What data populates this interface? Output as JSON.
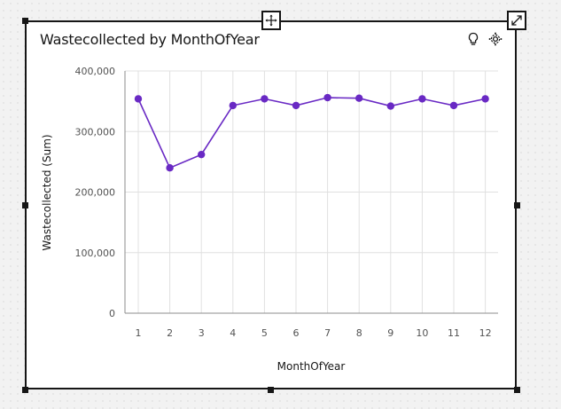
{
  "card": {
    "title": "Wastecollected by MonthOfYear"
  },
  "icons": {
    "move": "move-icon",
    "expand": "expand-icon",
    "insight": "lightbulb-icon",
    "settings": "settings-icon"
  },
  "colors": {
    "series": "#6929c4",
    "grid": "#e0e0e0",
    "axis": "#8d8d8d",
    "text": "#525252"
  },
  "chart_data": {
    "type": "line",
    "title": "Wastecollected by MonthOfYear",
    "xlabel": "MonthOfYear",
    "ylabel": "Wastecollected (Sum)",
    "x": [
      "1",
      "2",
      "3",
      "4",
      "5",
      "6",
      "7",
      "8",
      "9",
      "10",
      "11",
      "12"
    ],
    "series": [
      {
        "values": [
          354000,
          240000,
          262000,
          343000,
          354000,
          343000,
          356000,
          355000,
          342000,
          354000,
          343000,
          354000
        ]
      }
    ],
    "ylim": [
      0,
      400000
    ],
    "yticks": [
      0,
      100000,
      200000,
      300000,
      400000
    ],
    "ytick_labels": [
      "0",
      "100,000",
      "200,000",
      "300,000",
      "400,000"
    ],
    "grid": true,
    "legend": "none"
  }
}
